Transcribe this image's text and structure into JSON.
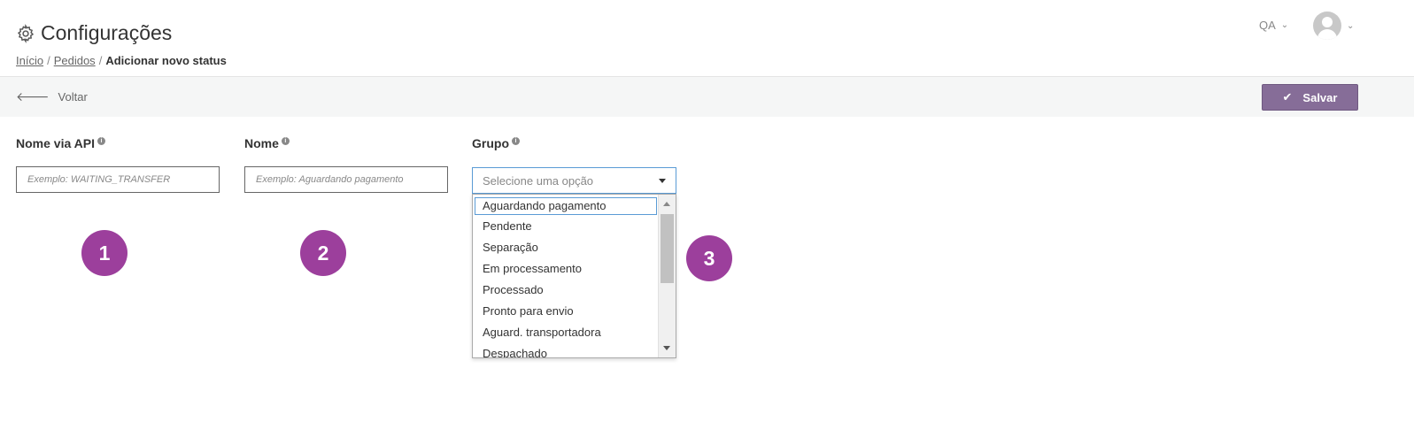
{
  "header": {
    "title": "Configurações",
    "breadcrumb": {
      "home": "Início",
      "separator": "/",
      "orders": "Pedidos",
      "current": "Adicionar novo status"
    },
    "user_label": "QA"
  },
  "toolbar": {
    "back_label": "Voltar",
    "save_label": "Salvar"
  },
  "form": {
    "api_name": {
      "label": "Nome via API",
      "placeholder": "Exemplo: WAITING_TRANSFER"
    },
    "name": {
      "label": "Nome",
      "placeholder": "Exemplo: Aguardando pagamento"
    },
    "group": {
      "label": "Grupo",
      "placeholder": "Selecione uma opção",
      "options": [
        "Aguardando pagamento",
        "Pendente",
        "Separação",
        "Em processamento",
        "Processado",
        "Pronto para envio",
        "Aguard. transportadora",
        "Despachado"
      ]
    }
  },
  "annotations": [
    "1",
    "2",
    "3"
  ],
  "colors": {
    "primary": "#866d98",
    "badge": "#9c3f9c",
    "focus": "#5a9bd5"
  }
}
